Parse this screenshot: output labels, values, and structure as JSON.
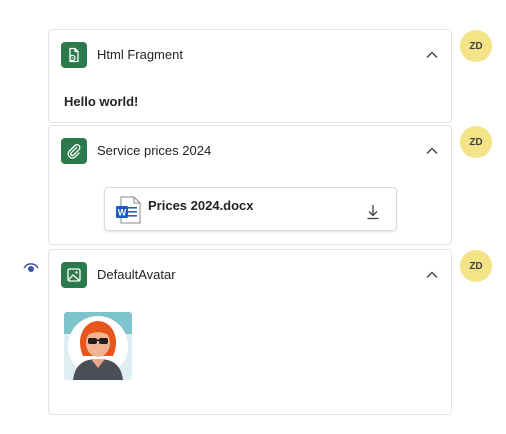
{
  "cards": [
    {
      "title": "Html Fragment",
      "icon": "file-code-icon",
      "avatar_initials": "ZD",
      "body_text": "Hello world!"
    },
    {
      "title": "Service prices 2024",
      "icon": "paperclip-icon",
      "avatar_initials": "ZD",
      "attachment": {
        "file_name": "Prices 2024.docx",
        "file_icon": "word-document-icon",
        "action_icon": "download-icon"
      }
    },
    {
      "title": "DefaultAvatar",
      "icon": "image-icon",
      "avatar_initials": "ZD",
      "visibility_icon": "eye-icon",
      "image": "avatar-illustration"
    }
  ],
  "colors": {
    "icon_tile": "#2b7a4b",
    "avatar_badge": "#f3e487",
    "card_border": "#e3e3e3"
  }
}
